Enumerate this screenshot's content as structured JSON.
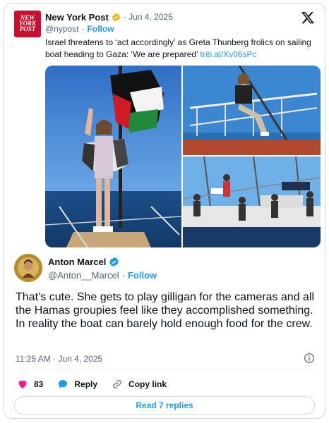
{
  "quoted_post": {
    "logo_text": [
      "NEW",
      "YORK",
      "POST"
    ],
    "author_name": "New York Post",
    "date": "· Jun 4, 2025",
    "handle": "@nypost",
    "separator": "·",
    "follow_label": "Follow",
    "text": "Israel threatens to ‘act accordingly’ as Greta Thunberg frolics on sailing boat heading to Gaza: ‘We are prepared’ ",
    "link_text": "trib.al/Xv06sPc",
    "verified_badge_color": "#e2b719"
  },
  "reply_post": {
    "author_name": "Anton Marcel",
    "handle": "@Anton__Marcel",
    "separator": "·",
    "follow_label": "Follow",
    "text": "That’s cute. She gets to play gilligan for the cameras and all the Hamas groupies feel like they accomplished something. In reality the boat can barely hold enough food for the crew.",
    "timestamp": "11:25 AM · Jun 4, 2025",
    "verified_badge_color": "#1d9bf0"
  },
  "actions": {
    "like_count": "83",
    "reply_label": "Reply",
    "copy_link_label": "Copy link",
    "read_replies_label": "Read 7 replies"
  },
  "icons": {
    "brand": "x-logo-icon",
    "like": "heart-icon",
    "reply": "speech-bubble-icon",
    "copy": "link-icon",
    "info": "info-icon"
  },
  "colors": {
    "accent": "#1d9bf0",
    "like": "#f91880",
    "brand_red": "#c8102e"
  }
}
